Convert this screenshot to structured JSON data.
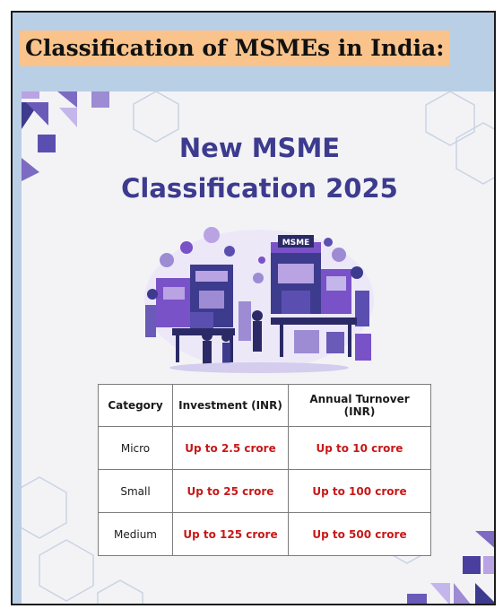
{
  "heading": "Classification of MSMEs in India:",
  "poster": {
    "title_line1": "New MSME",
    "title_line2": "Classification 2025",
    "illustration": {
      "sign_text": "MSME",
      "colors": {
        "primary": "#3d3b8e",
        "accent": "#7a52c8",
        "light": "#b9a3e3"
      }
    }
  },
  "table": {
    "headers": [
      "Category",
      "Investment (INR)",
      "Annual Turnover (INR)"
    ],
    "rows": [
      {
        "category": "Micro",
        "investment": "Up to 2.5 crore",
        "turnover": "Up to 10 crore"
      },
      {
        "category": "Small",
        "investment": "Up to 25 crore",
        "turnover": "Up to 100 crore"
      },
      {
        "category": "Medium",
        "investment": "Up to 125 crore",
        "turnover": "Up to 500 crore"
      }
    ]
  },
  "colors": {
    "page_background": "#b9cfe6",
    "heading_highlight": "#f9c38b",
    "title": "#3d3b8e",
    "limit_values": "#c71818"
  }
}
